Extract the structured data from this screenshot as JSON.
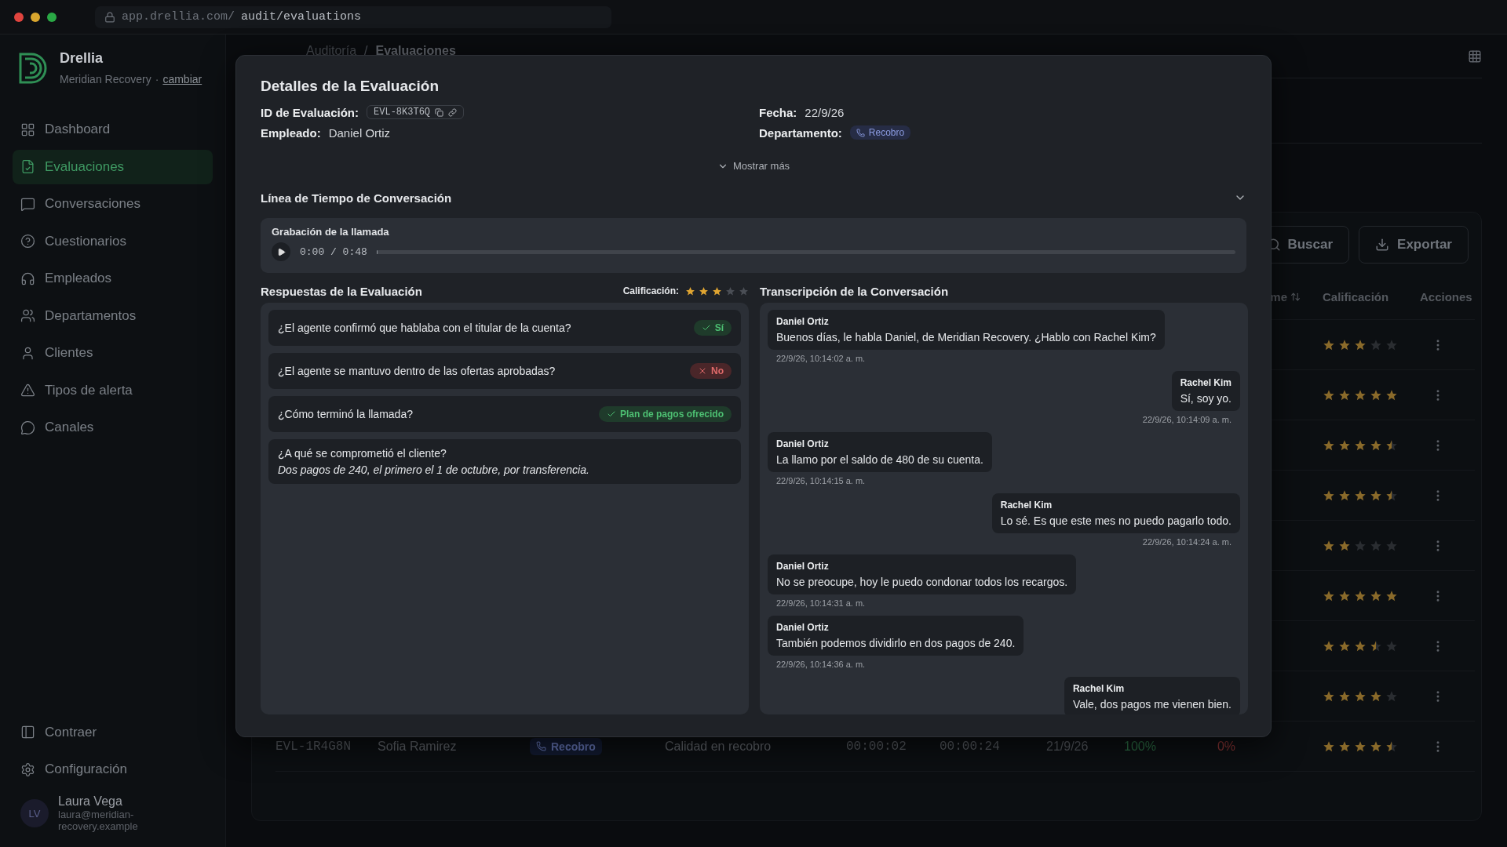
{
  "browser": {
    "url_host": "app.drellia.com/",
    "url_path": "audit/evaluations"
  },
  "sidebar": {
    "brand": "Drellia",
    "org": "Meridian Recovery",
    "separator": "·",
    "switch_link": "cambiar",
    "items": [
      {
        "label": "Dashboard",
        "selected": false
      },
      {
        "label": "Evaluaciones",
        "selected": true
      },
      {
        "label": "Conversaciones",
        "selected": false
      },
      {
        "label": "Cuestionarios",
        "selected": false
      },
      {
        "label": "Empleados",
        "selected": false
      },
      {
        "label": "Departamentos",
        "selected": false
      },
      {
        "label": "Clientes",
        "selected": false
      },
      {
        "label": "Tipos de alerta",
        "selected": false
      },
      {
        "label": "Canales",
        "selected": false
      }
    ],
    "footer_items": [
      {
        "label": "Contraer"
      },
      {
        "label": "Configuración"
      }
    ],
    "user": {
      "initials": "LV",
      "name": "Laura Vega",
      "email": "laura@meridian-recovery.example"
    }
  },
  "breadcrumb": {
    "items": [
      "Auditoría",
      "Evaluaciones"
    ],
    "separator": "/"
  },
  "table": {
    "toolbar": {
      "search": "Buscar",
      "export": "Exportar"
    },
    "columns": [
      "me",
      "Calificación",
      "Acciones"
    ],
    "rows": [
      {
        "stars": 3
      },
      {
        "stars": 5
      },
      {
        "stars": 4.5
      },
      {
        "stars": 4.5
      },
      {
        "stars": 2
      },
      {
        "stars": 5
      },
      {
        "stars": 3.5
      },
      {
        "stars": 4
      },
      {
        "id": "EVL-1R4G8N",
        "employee": "Sofia Ramirez",
        "department": "Recobro",
        "questionnaire": "Calidad en recobro",
        "duration_1": "00:00:02",
        "duration_2": "00:00:24",
        "date": "21/9/26",
        "percent_1": "100%",
        "percent_2": "0%",
        "stars": 4.5
      }
    ]
  },
  "modal": {
    "title": "Detalles de la Evaluación",
    "fields": [
      {
        "label": "ID de Evaluación:",
        "value": "EVL-8K3T6Q",
        "kind": "code"
      },
      {
        "label": "Fecha:",
        "value": "22/9/26",
        "kind": "text"
      },
      {
        "label": "Empleado:",
        "value": "Daniel Ortiz",
        "kind": "text"
      },
      {
        "label": "Departamento:",
        "value": "Recobro",
        "kind": "badge"
      }
    ],
    "show_more": "Mostrar más",
    "timeline_title": "Línea de Tiempo de Conversación",
    "recording": {
      "title": "Grabación de la llamada",
      "time": "0:00 / 0:48",
      "level": 0
    },
    "answers": {
      "title": "Respuestas de la Evaluación",
      "rating_label": "Calificación:",
      "stars": 3,
      "items": [
        {
          "question": "¿El agente confirmó que hablaba con el titular de la cuenta?",
          "kind": "chip",
          "answer": "Sí",
          "passed": true
        },
        {
          "question": "¿El agente se mantuvo dentro de las ofertas aprobadas?",
          "kind": "chip",
          "answer": "No",
          "passed": false
        },
        {
          "question": "¿Cómo terminó la llamada?",
          "kind": "chip",
          "answer": "Plan de pagos ofrecido",
          "passed": true
        },
        {
          "question": "¿A qué se comprometió el cliente?",
          "kind": "text",
          "answer": "Dos pagos de 240, el primero el 1 de octubre, por transferencia."
        }
      ]
    },
    "transcript": {
      "title": "Transcripción de la Conversación",
      "messages": [
        {
          "speaker": "Daniel Ortiz",
          "outgoing": false,
          "text": "Buenos días, le habla Daniel, de Meridian Recovery. ¿Hablo con Rachel Kim?",
          "time": "22/9/26, 10:14:02 a. m."
        },
        {
          "speaker": "Rachel Kim",
          "outgoing": true,
          "text": "Sí, soy yo.",
          "time": "22/9/26, 10:14:09 a. m."
        },
        {
          "speaker": "Daniel Ortiz",
          "outgoing": false,
          "text": "La llamo por el saldo de 480 de su cuenta.",
          "time": "22/9/26, 10:14:15 a. m."
        },
        {
          "speaker": "Rachel Kim",
          "outgoing": true,
          "text": "Lo sé. Es que este mes no puedo pagarlo todo.",
          "time": "22/9/26, 10:14:24 a. m."
        },
        {
          "speaker": "Daniel Ortiz",
          "outgoing": false,
          "text": "No se preocupe, hoy le puedo condonar todos los recargos.",
          "time": "22/9/26, 10:14:31 a. m."
        },
        {
          "speaker": "Daniel Ortiz",
          "outgoing": false,
          "text": "También podemos dividirlo en dos pagos de 240.",
          "time": "22/9/26, 10:14:36 a. m."
        },
        {
          "speaker": "Rachel Kim",
          "outgoing": true,
          "text": "Vale, dos pagos me vienen bien."
        }
      ]
    }
  }
}
